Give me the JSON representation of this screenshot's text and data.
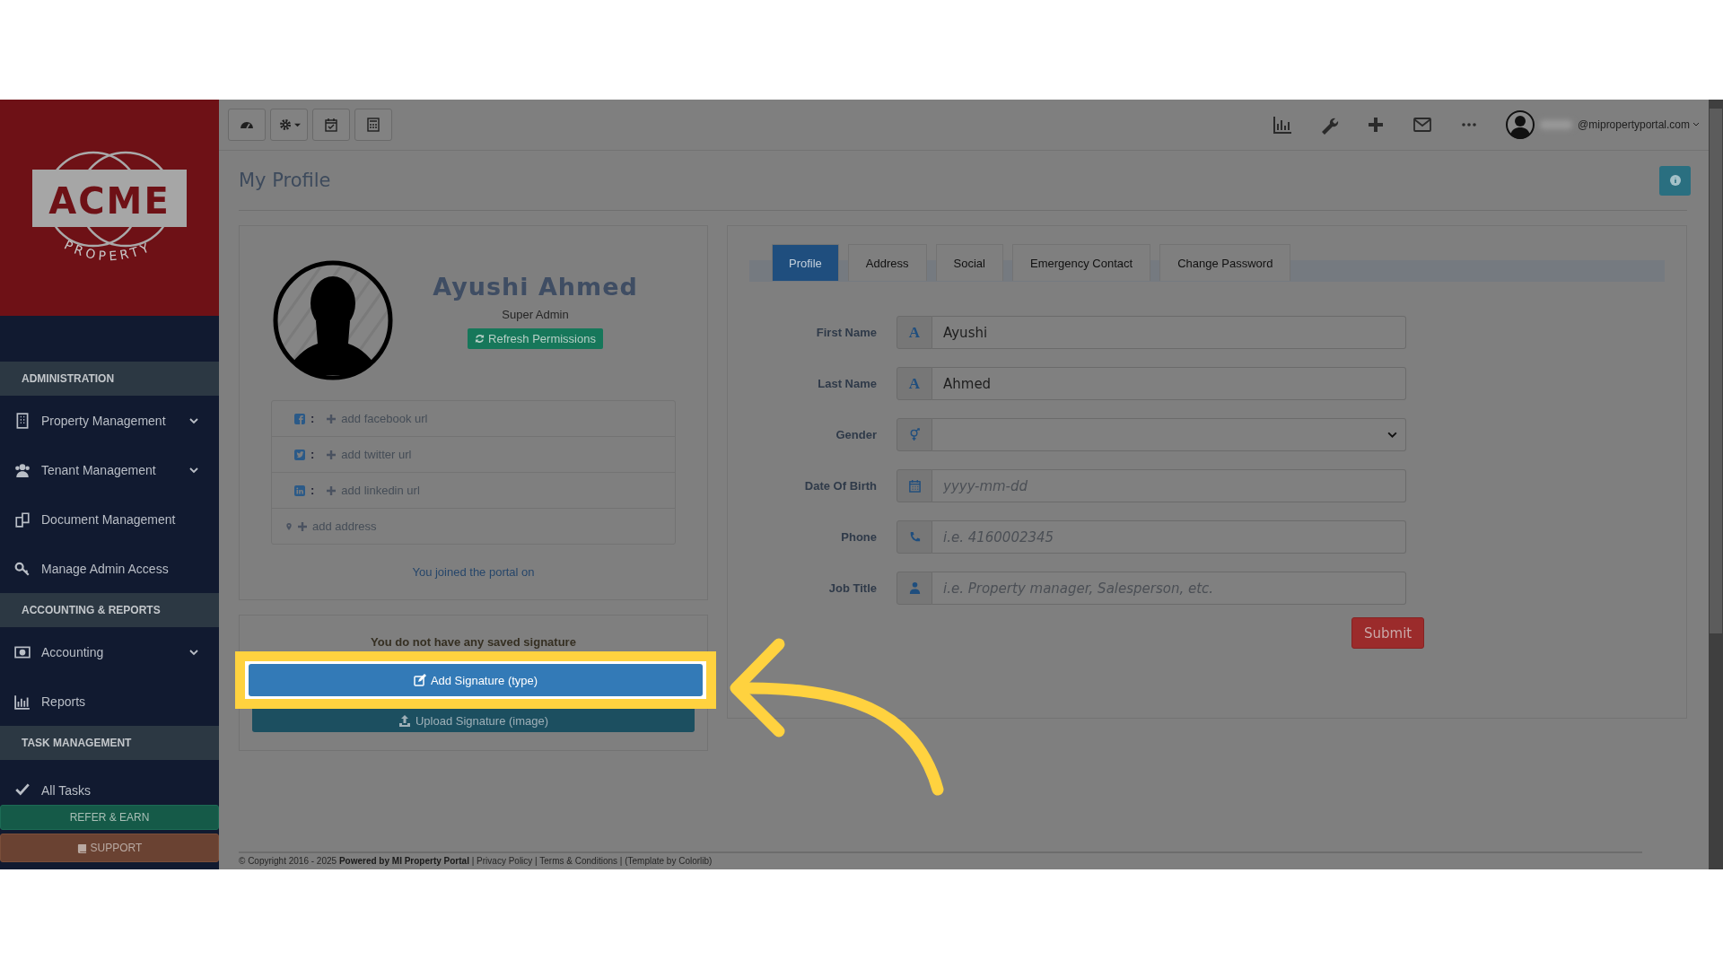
{
  "sidebar": {
    "logo": {
      "word": "ACME",
      "sub": "PROPERTY"
    },
    "sections": [
      {
        "title": "ADMINISTRATION",
        "items": [
          {
            "label": "Property Management",
            "expandable": true
          },
          {
            "label": "Tenant Management",
            "expandable": true
          },
          {
            "label": "Document Management",
            "expandable": false
          },
          {
            "label": "Manage Admin Access",
            "expandable": false
          }
        ]
      },
      {
        "title": "ACCOUNTING & REPORTS",
        "items": [
          {
            "label": "Accounting",
            "expandable": true
          },
          {
            "label": "Reports",
            "expandable": false
          }
        ]
      },
      {
        "title": "TASK MANAGEMENT",
        "items": [
          {
            "label": "All Tasks",
            "expandable": false
          }
        ]
      }
    ],
    "refer_button": "REFER & EARN",
    "support_button": "SUPPORT"
  },
  "user_menu": {
    "email": "@mipropertyportal.com"
  },
  "page_title": "My Profile",
  "profile_card": {
    "name": "Ayushi Ahmed",
    "role": "Super Admin",
    "refresh_button": "Refresh Permissions",
    "links": [
      {
        "kind": "facebook",
        "separator": ":",
        "text": "add facebook url"
      },
      {
        "kind": "twitter",
        "separator": ":",
        "text": "add twitter url"
      },
      {
        "kind": "linkedin",
        "separator": ":",
        "text": "add linkedin url"
      },
      {
        "kind": "address",
        "text": "add address"
      }
    ],
    "joined_text": "You joined the portal on"
  },
  "signature_card": {
    "message": "You do not have any saved signature",
    "buttons": [
      {
        "kind": "type",
        "label": "Add Signature (type)",
        "highlighted": true
      },
      {
        "kind": "upload",
        "label": "Upload Signature (image)",
        "highlighted": false
      }
    ]
  },
  "tabs": [
    {
      "label": "Profile",
      "selected": true
    },
    {
      "label": "Address",
      "selected": false
    },
    {
      "label": "Social",
      "selected": false
    },
    {
      "label": "Emergency Contact",
      "selected": false
    },
    {
      "label": "Change Password",
      "selected": false
    }
  ],
  "form": {
    "fields": [
      {
        "label": "First Name",
        "kind": "text",
        "icon": "A",
        "value": "Ayushi"
      },
      {
        "label": "Last Name",
        "kind": "text",
        "icon": "A",
        "value": "Ahmed"
      },
      {
        "label": "Gender",
        "kind": "select"
      },
      {
        "label": "Date Of Birth",
        "kind": "date",
        "placeholder": "yyyy-mm-dd"
      },
      {
        "label": "Phone",
        "kind": "phone",
        "placeholder": "i.e. 4160002345"
      },
      {
        "label": "Job Title",
        "kind": "job",
        "placeholder": "i.e. Property manager, Salesperson, etc."
      }
    ],
    "submit": "Submit"
  },
  "footer": "© Copyright 2016 - 2025 **Powered by MI Property Portal** | Privacy Policy | Terms & Conditions | (Template by Colorlib)"
}
